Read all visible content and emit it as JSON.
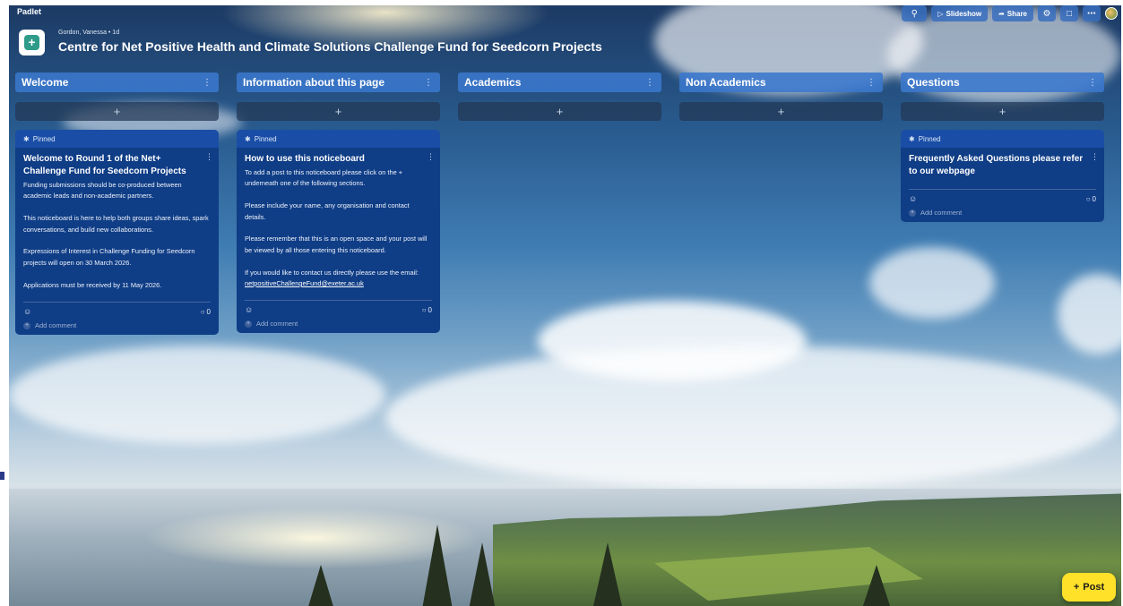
{
  "app": {
    "brand": "Padlet"
  },
  "board": {
    "author_meta": "Gordon, Vanessa • 1d",
    "title": "Centre for Net Positive Health and Climate Solutions Challenge Fund for Seedcorn Projects",
    "icon": "plus-square-icon"
  },
  "toolbar": {
    "search_icon": "search-icon",
    "slideshow_label": "Slideshow",
    "share_label": "Share",
    "settings_icon": "gear-icon",
    "remake_icon": "copy-icon",
    "more_icon": "more-icon"
  },
  "columns": [
    {
      "title": "Welcome"
    },
    {
      "title": "Information about this page"
    },
    {
      "title": "Academics"
    },
    {
      "title": "Non Academics"
    },
    {
      "title": "Questions"
    }
  ],
  "cards": {
    "welcome": {
      "pinned": "Pinned",
      "title": "Welcome to Round 1 of the Net+ Challenge Fund for Seedcorn Projects",
      "p1": "Funding submissions should be co-produced between academic leads and non-academic partners.",
      "p2": "This noticeboard is here to help both groups share ideas, spark conversations, and build new collaborations.",
      "p3": "Expressions of Interest  in Challenge Funding for Seedcorn projects will open on 30 March 2026.",
      "p4": "Applications must be received by 11 May 2026.",
      "comments": "0",
      "add_comment": "Add comment"
    },
    "info": {
      "pinned": "Pinned",
      "title": "How to use this noticeboard",
      "p1": "To add a post to this noticeboard please click on the + underneath one of the following sections.",
      "p2": "Please include your name, any organisation and contact details.",
      "p3": "Please remember that this is an open space and your post will be viewed by all those entering this noticeboard.",
      "p4_prefix": "If you would like to contact us directly please use the email: ",
      "email": "netpositiveChallengeFund@exeter.ac.uk",
      "comments": "0",
      "add_comment": "Add comment"
    },
    "questions": {
      "pinned": "Pinned",
      "title": "Frequently Asked Questions please refer to our webpage",
      "comments": "0",
      "add_comment": "Add comment"
    }
  },
  "post_button": {
    "label": "Post"
  }
}
